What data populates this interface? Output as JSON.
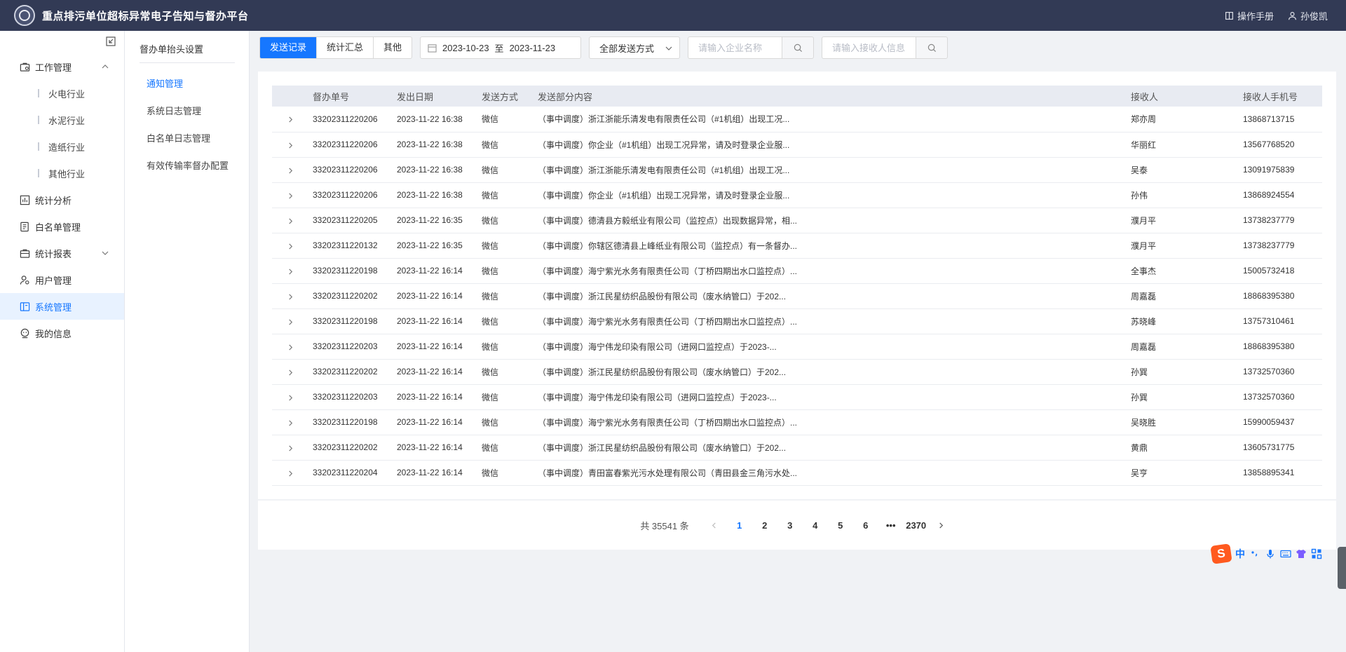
{
  "header": {
    "title": "重点排污单位超标异常电子告知与督办平台",
    "manual": "操作手册",
    "user": "孙俊凯"
  },
  "sidebar": {
    "items": [
      {
        "label": "工作管理",
        "icon": "briefcase-icon"
      },
      {
        "label": "火电行业"
      },
      {
        "label": "水泥行业"
      },
      {
        "label": "造纸行业"
      },
      {
        "label": "其他行业"
      },
      {
        "label": "统计分析",
        "icon": "chart-icon"
      },
      {
        "label": "白名单管理",
        "icon": "document-icon"
      },
      {
        "label": "统计报表",
        "icon": "report-icon"
      },
      {
        "label": "用户管理",
        "icon": "user-icon"
      },
      {
        "label": "系统管理",
        "icon": "system-icon"
      },
      {
        "label": "我的信息",
        "icon": "profile-icon"
      }
    ]
  },
  "subpanel": {
    "title": "督办单抬头设置",
    "items": [
      "通知管理",
      "系统日志管理",
      "白名单日志管理",
      "有效传输率督办配置"
    ]
  },
  "toolbar": {
    "tabs": [
      "发送记录",
      "统计汇总",
      "其他"
    ],
    "date_start": "2023-10-23",
    "date_sep": "至",
    "date_end": "2023-11-23",
    "send_mode": "全部发送方式",
    "company_placeholder": "请输入企业名称",
    "receiver_placeholder": "请输入接收人信息"
  },
  "table": {
    "headers": [
      "督办单号",
      "发出日期",
      "发送方式",
      "发送部分内容",
      "接收人",
      "接收人手机号"
    ],
    "rows": [
      [
        "33202311220206",
        "2023-11-22 16:38",
        "微信",
        "（事中调度）浙江浙能乐清发电有限责任公司（#1机组）出现工况...",
        "郑亦周",
        "13868713715"
      ],
      [
        "33202311220206",
        "2023-11-22 16:38",
        "微信",
        "（事中调度）你企业（#1机组）出现工况异常，请及时登录企业服...",
        "华丽红",
        "13567768520"
      ],
      [
        "33202311220206",
        "2023-11-22 16:38",
        "微信",
        "（事中调度）浙江浙能乐清发电有限责任公司（#1机组）出现工况...",
        "吴泰",
        "13091975839"
      ],
      [
        "33202311220206",
        "2023-11-22 16:38",
        "微信",
        "（事中调度）你企业（#1机组）出现工况异常，请及时登录企业服...",
        "孙伟",
        "13868924554"
      ],
      [
        "33202311220205",
        "2023-11-22 16:35",
        "微信",
        "（事中调度）德清县方毅纸业有限公司（监控点）出现数据异常，相...",
        "濮月平",
        "13738237779"
      ],
      [
        "33202311220132",
        "2023-11-22 16:35",
        "微信",
        "（事中调度）你辖区德清县上峰纸业有限公司（监控点）有一条督办...",
        "濮月平",
        "13738237779"
      ],
      [
        "33202311220198",
        "2023-11-22 16:14",
        "微信",
        "（事中调度）海宁紫光水务有限责任公司（丁桥四期出水口监控点）...",
        "全事杰",
        "15005732418"
      ],
      [
        "33202311220202",
        "2023-11-22 16:14",
        "微信",
        "（事中调度）浙江民星纺织品股份有限公司（废水纳管口）于202...",
        "周嘉磊",
        "18868395380"
      ],
      [
        "33202311220198",
        "2023-11-22 16:14",
        "微信",
        "（事中调度）海宁紫光水务有限责任公司（丁桥四期出水口监控点）...",
        "苏晓峰",
        "13757310461"
      ],
      [
        "33202311220203",
        "2023-11-22 16:14",
        "微信",
        "（事中调度）海宁伟龙印染有限公司（进网口监控点）于2023-...",
        "周嘉磊",
        "18868395380"
      ],
      [
        "33202311220202",
        "2023-11-22 16:14",
        "微信",
        "（事中调度）浙江民星纺织品股份有限公司（废水纳管口）于202...",
        "孙巽",
        "13732570360"
      ],
      [
        "33202311220203",
        "2023-11-22 16:14",
        "微信",
        "（事中调度）海宁伟龙印染有限公司（进网口监控点）于2023-...",
        "孙巽",
        "13732570360"
      ],
      [
        "33202311220198",
        "2023-11-22 16:14",
        "微信",
        "（事中调度）海宁紫光水务有限责任公司（丁桥四期出水口监控点）...",
        "吴晓胜",
        "15990059437"
      ],
      [
        "33202311220202",
        "2023-11-22 16:14",
        "微信",
        "（事中调度）浙江民星纺织品股份有限公司（废水纳管口）于202...",
        "黄鼎",
        "13605731775"
      ],
      [
        "33202311220204",
        "2023-11-22 16:14",
        "微信",
        "（事中调度）青田富春紫光污水处理有限公司（青田县金三角污水处...",
        "吴亨",
        "13858895341"
      ]
    ]
  },
  "pagination": {
    "total": "共 35541 条",
    "pages": [
      "1",
      "2",
      "3",
      "4",
      "5",
      "6",
      "•••",
      "2370"
    ],
    "current": "1"
  },
  "ime": {
    "logo": "S",
    "mode": "中"
  },
  "colors": {
    "header_bg": "#323a55",
    "accent": "#1677ff",
    "active_bg": "#e8f2ff"
  }
}
